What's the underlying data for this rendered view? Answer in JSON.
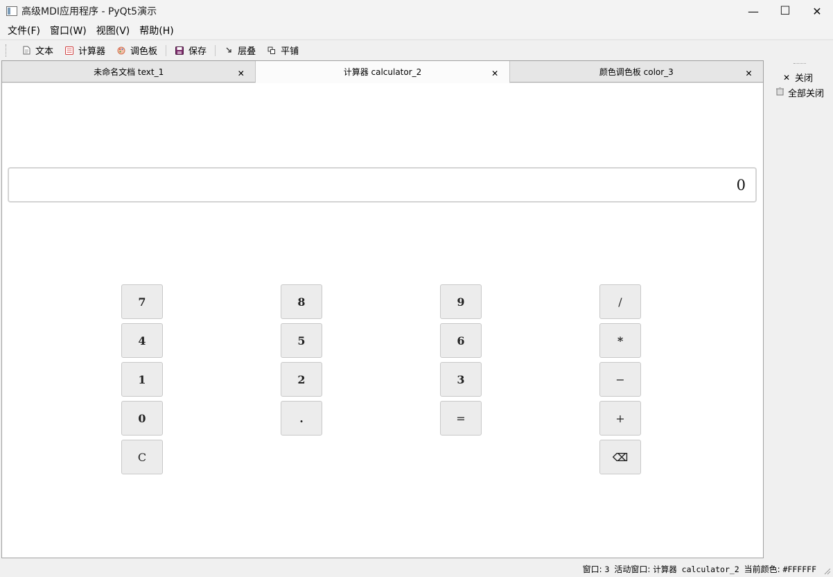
{
  "window": {
    "title": "高级MDI应用程序 - PyQt5演示",
    "minimize": "—",
    "maximize": "☐",
    "close": "✕"
  },
  "menubar": {
    "items": [
      "文件(F)",
      "窗口(W)",
      "视图(V)",
      "帮助(H)"
    ]
  },
  "toolbar": {
    "items": [
      {
        "label": "文本",
        "icon": "document-icon"
      },
      {
        "label": "计算器",
        "icon": "calculator-icon"
      },
      {
        "label": "调色板",
        "icon": "palette-icon"
      },
      {
        "label": "保存",
        "icon": "save-icon"
      },
      {
        "label": "层叠",
        "icon": "cascade-icon"
      },
      {
        "label": "平铺",
        "icon": "tile-icon"
      }
    ]
  },
  "tabs": [
    {
      "label": "未命名文档 text_1",
      "active": false
    },
    {
      "label": "计算器 calculator_2",
      "active": true
    },
    {
      "label": "颜色调色板 color_3",
      "active": false
    }
  ],
  "calculator": {
    "display": "0",
    "buttons": [
      "7",
      "8",
      "9",
      "/",
      "4",
      "5",
      "6",
      "*",
      "1",
      "2",
      "3",
      "−",
      "0",
      ".",
      "=",
      "+",
      "C",
      "⌫"
    ]
  },
  "side_panel": {
    "close_label": "关闭",
    "close_all_label": "全部关闭"
  },
  "status": {
    "window_count_label": "窗口: ",
    "window_count": "3",
    "active_label": "活动窗口: ",
    "active_value": "计算器 calculator_2",
    "color_label": "当前颜色: ",
    "color_value": "#FFFFFF"
  },
  "colors": {
    "window_bg": "#f0f0f0",
    "tab_active_bg": "#fbfbfb",
    "button_bg": "#ececec"
  }
}
